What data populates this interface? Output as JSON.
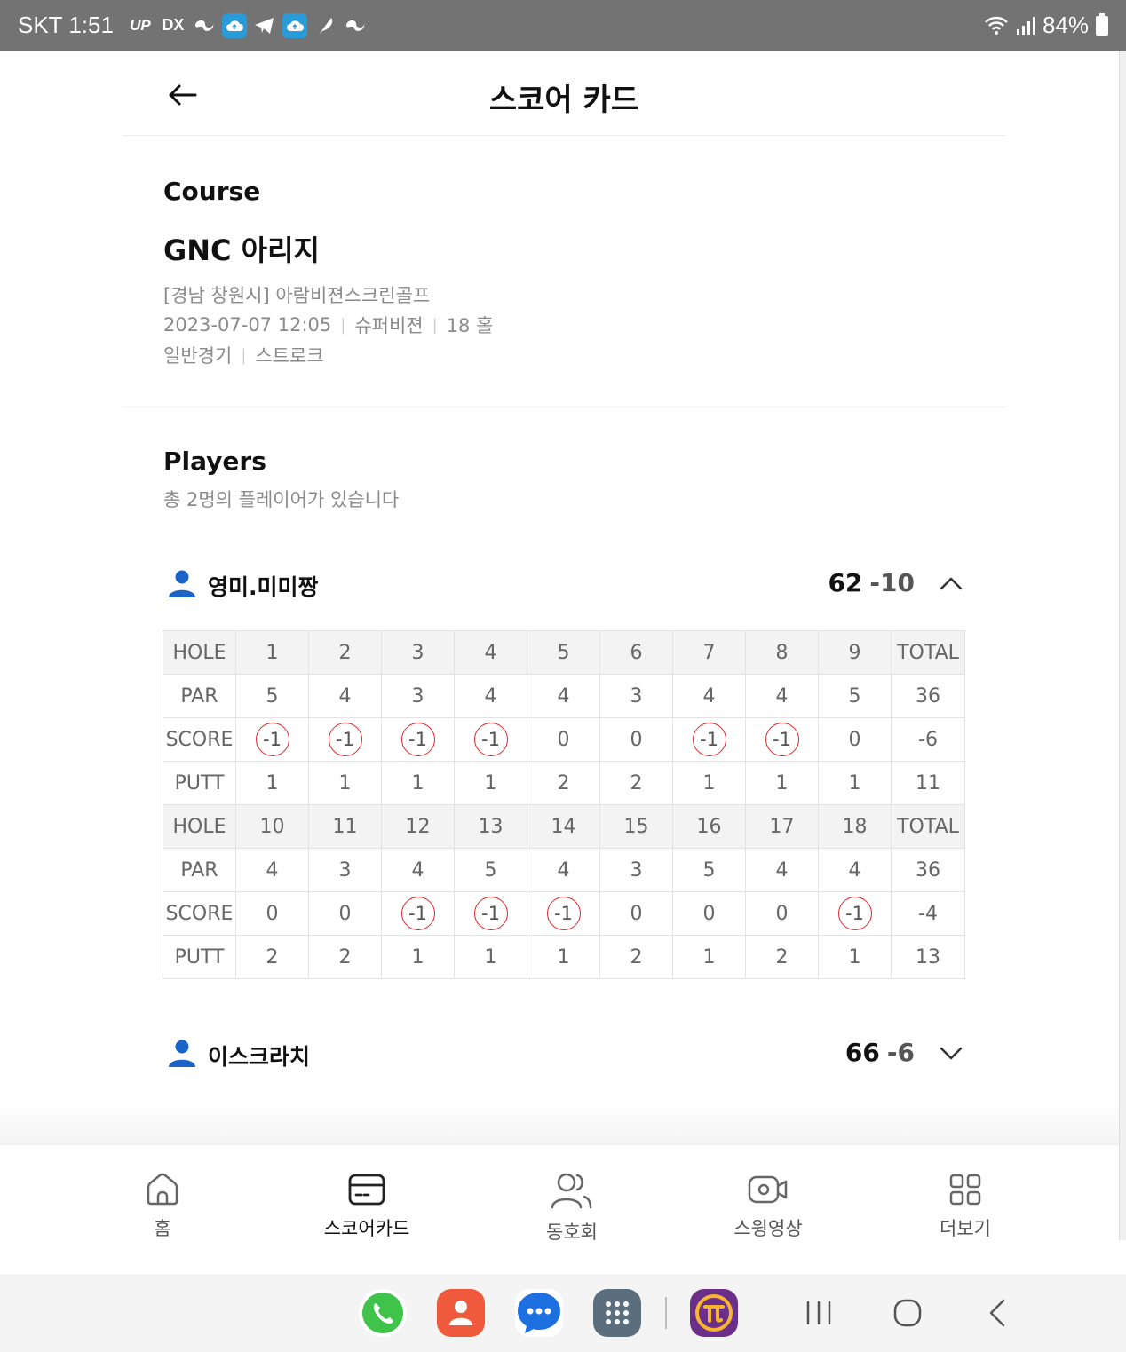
{
  "status_bar": {
    "carrier_time": "SKT 1:51",
    "icons": [
      "up-icon",
      "dx-icon",
      "wave-icon",
      "cloud-upload-icon",
      "telegram-icon",
      "cloud-upload-icon",
      "feather-icon",
      "wave-icon"
    ],
    "up_label": "UP",
    "dx_label": "DX",
    "battery": "84%"
  },
  "header": {
    "title": "스코어 카드"
  },
  "course": {
    "section_label": "Course",
    "name": "GNC 아리지",
    "location": "[경남 창원시] 아람비젼스크린골프",
    "datetime": "2023-07-07 12:05",
    "system": "슈퍼비젼",
    "holes": "18 홀",
    "game_type": "일반경기",
    "scoring": "스트로크"
  },
  "players_section": {
    "label": "Players",
    "subtitle": "총 2명의 플레이어가 있습니다"
  },
  "players": [
    {
      "name": "영미.미미짱",
      "total": "62",
      "diff": "-10",
      "expanded": true
    },
    {
      "name": "이스크라치",
      "total": "66",
      "diff": "-6",
      "expanded": false
    }
  ],
  "scorecard": {
    "row_labels": {
      "hole": "HOLE",
      "par": "PAR",
      "score": "SCORE",
      "putt": "PUTT",
      "total": "TOTAL"
    },
    "front": {
      "holes": [
        "1",
        "2",
        "3",
        "4",
        "5",
        "6",
        "7",
        "8",
        "9"
      ],
      "par": [
        "5",
        "4",
        "3",
        "4",
        "4",
        "3",
        "4",
        "4",
        "5"
      ],
      "par_total": "36",
      "score": [
        "-1",
        "-1",
        "-1",
        "-1",
        "0",
        "0",
        "-1",
        "-1",
        "0"
      ],
      "score_total": "-6",
      "putt": [
        "1",
        "1",
        "1",
        "1",
        "2",
        "2",
        "1",
        "1",
        "1"
      ],
      "putt_total": "11"
    },
    "back": {
      "holes": [
        "10",
        "11",
        "12",
        "13",
        "14",
        "15",
        "16",
        "17",
        "18"
      ],
      "par": [
        "4",
        "3",
        "4",
        "5",
        "4",
        "3",
        "5",
        "4",
        "4"
      ],
      "par_total": "36",
      "score": [
        "0",
        "0",
        "-1",
        "-1",
        "-1",
        "0",
        "0",
        "0",
        "-1"
      ],
      "score_total": "-4",
      "putt": [
        "2",
        "2",
        "1",
        "1",
        "1",
        "2",
        "1",
        "2",
        "1"
      ],
      "putt_total": "13"
    },
    "birdie_circle_color": "#e0282c"
  },
  "bottom_nav": [
    {
      "label": "홈",
      "icon": "home-icon",
      "active": false
    },
    {
      "label": "스코어카드",
      "icon": "scorecard-icon",
      "active": true
    },
    {
      "label": "동호회",
      "icon": "club-icon",
      "active": false
    },
    {
      "label": "스윙영상",
      "icon": "video-icon",
      "active": false
    },
    {
      "label": "더보기",
      "icon": "more-icon",
      "active": false
    }
  ],
  "dock": [
    "phone-app-icon",
    "contacts-app-icon",
    "messages-app-icon",
    "apps-grid-icon",
    "pi-app-icon"
  ],
  "colors": {
    "accent_blue": "#1a64c8",
    "status_bar_bg": "#737373",
    "birdie_red": "#e0282c"
  }
}
